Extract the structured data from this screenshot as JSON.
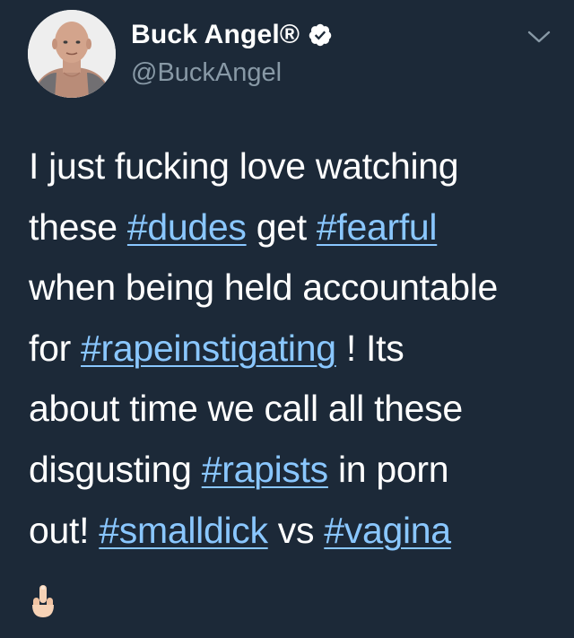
{
  "user": {
    "display_name": "Buck Angel",
    "registered_mark": "®",
    "handle": "@BuckAngel",
    "verified": true
  },
  "icons": {
    "verified": "verified-badge-icon",
    "menu": "chevron-down-icon",
    "emoji": "middle-finger-emoji"
  },
  "colors": {
    "background": "#1c2938",
    "text": "#ffffff",
    "handle": "#8899a6",
    "hashtag": "#8ac7ff"
  },
  "tweet": {
    "lines": [
      [
        {
          "t": "text",
          "v": "I just fucking love watching"
        }
      ],
      [
        {
          "t": "text",
          "v": "these "
        },
        {
          "t": "hashtag",
          "v": "#dudes"
        },
        {
          "t": "text",
          "v": " get "
        },
        {
          "t": "hashtag",
          "v": "#fearful"
        }
      ],
      [
        {
          "t": "text",
          "v": "when being held accountable"
        }
      ],
      [
        {
          "t": "text",
          "v": "for "
        },
        {
          "t": "hashtag",
          "v": "#rapeinstigating"
        },
        {
          "t": "text",
          "v": " ! Its"
        }
      ],
      [
        {
          "t": "text",
          "v": "about time we call all these"
        }
      ],
      [
        {
          "t": "text",
          "v": "disgusting "
        },
        {
          "t": "hashtag",
          "v": "#rapists"
        },
        {
          "t": "text",
          "v": " in porn"
        }
      ],
      [
        {
          "t": "text",
          "v": "out! "
        },
        {
          "t": "hashtag",
          "v": "#smalldick"
        },
        {
          "t": "text",
          "v": " vs "
        },
        {
          "t": "hashtag",
          "v": "#vagina"
        }
      ],
      [
        {
          "t": "emoji",
          "v": "🖕"
        }
      ]
    ]
  }
}
